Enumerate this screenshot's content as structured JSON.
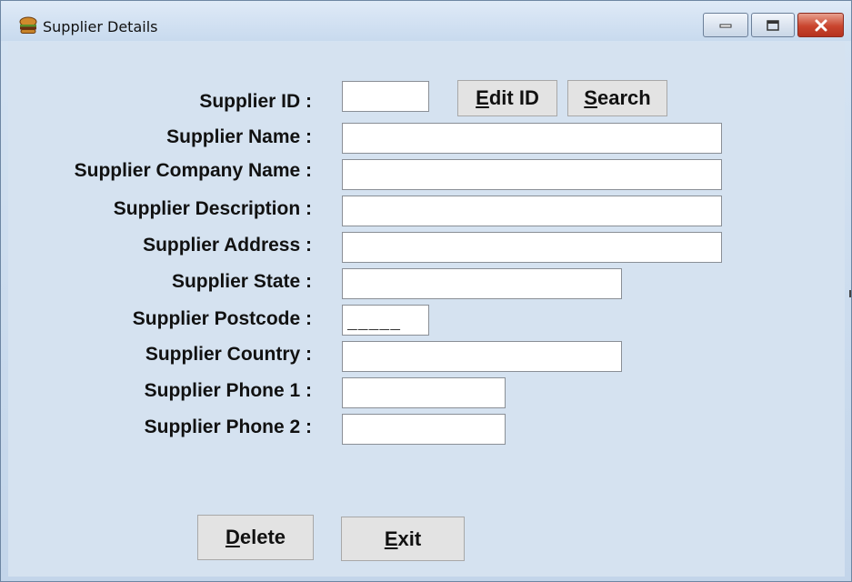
{
  "window": {
    "title": "Supplier Details",
    "icon": "burger-icon",
    "controls": {
      "minimize": "minimize-icon",
      "maximize": "maximize-icon",
      "close": "close-icon"
    }
  },
  "form": {
    "labels": {
      "supplier_id": "Supplier ID :",
      "supplier_name": "Supplier Name :",
      "company_name": "Supplier Company Name :",
      "description": "Supplier Description :",
      "address": "Supplier Address :",
      "state": "Supplier State :",
      "postcode": "Supplier Postcode :",
      "country": "Supplier Country :",
      "phone1": "Supplier Phone 1 :",
      "phone2": "Supplier Phone 2 :"
    },
    "values": {
      "supplier_id": "",
      "supplier_name": "",
      "company_name": "",
      "description": "",
      "address": "",
      "state": "",
      "postcode_mask": "_____",
      "country": "",
      "phone1": "",
      "phone2": ""
    }
  },
  "buttons": {
    "edit_id": {
      "accel": "E",
      "rest": "dit ID"
    },
    "search": {
      "accel": "S",
      "rest": "earch"
    },
    "delete": {
      "accel": "D",
      "rest": "elete"
    },
    "exit": {
      "accel": "E",
      "rest": "xit"
    }
  },
  "colors": {
    "client_bg": "#d5e2f0",
    "close_button": "#c9452e"
  }
}
